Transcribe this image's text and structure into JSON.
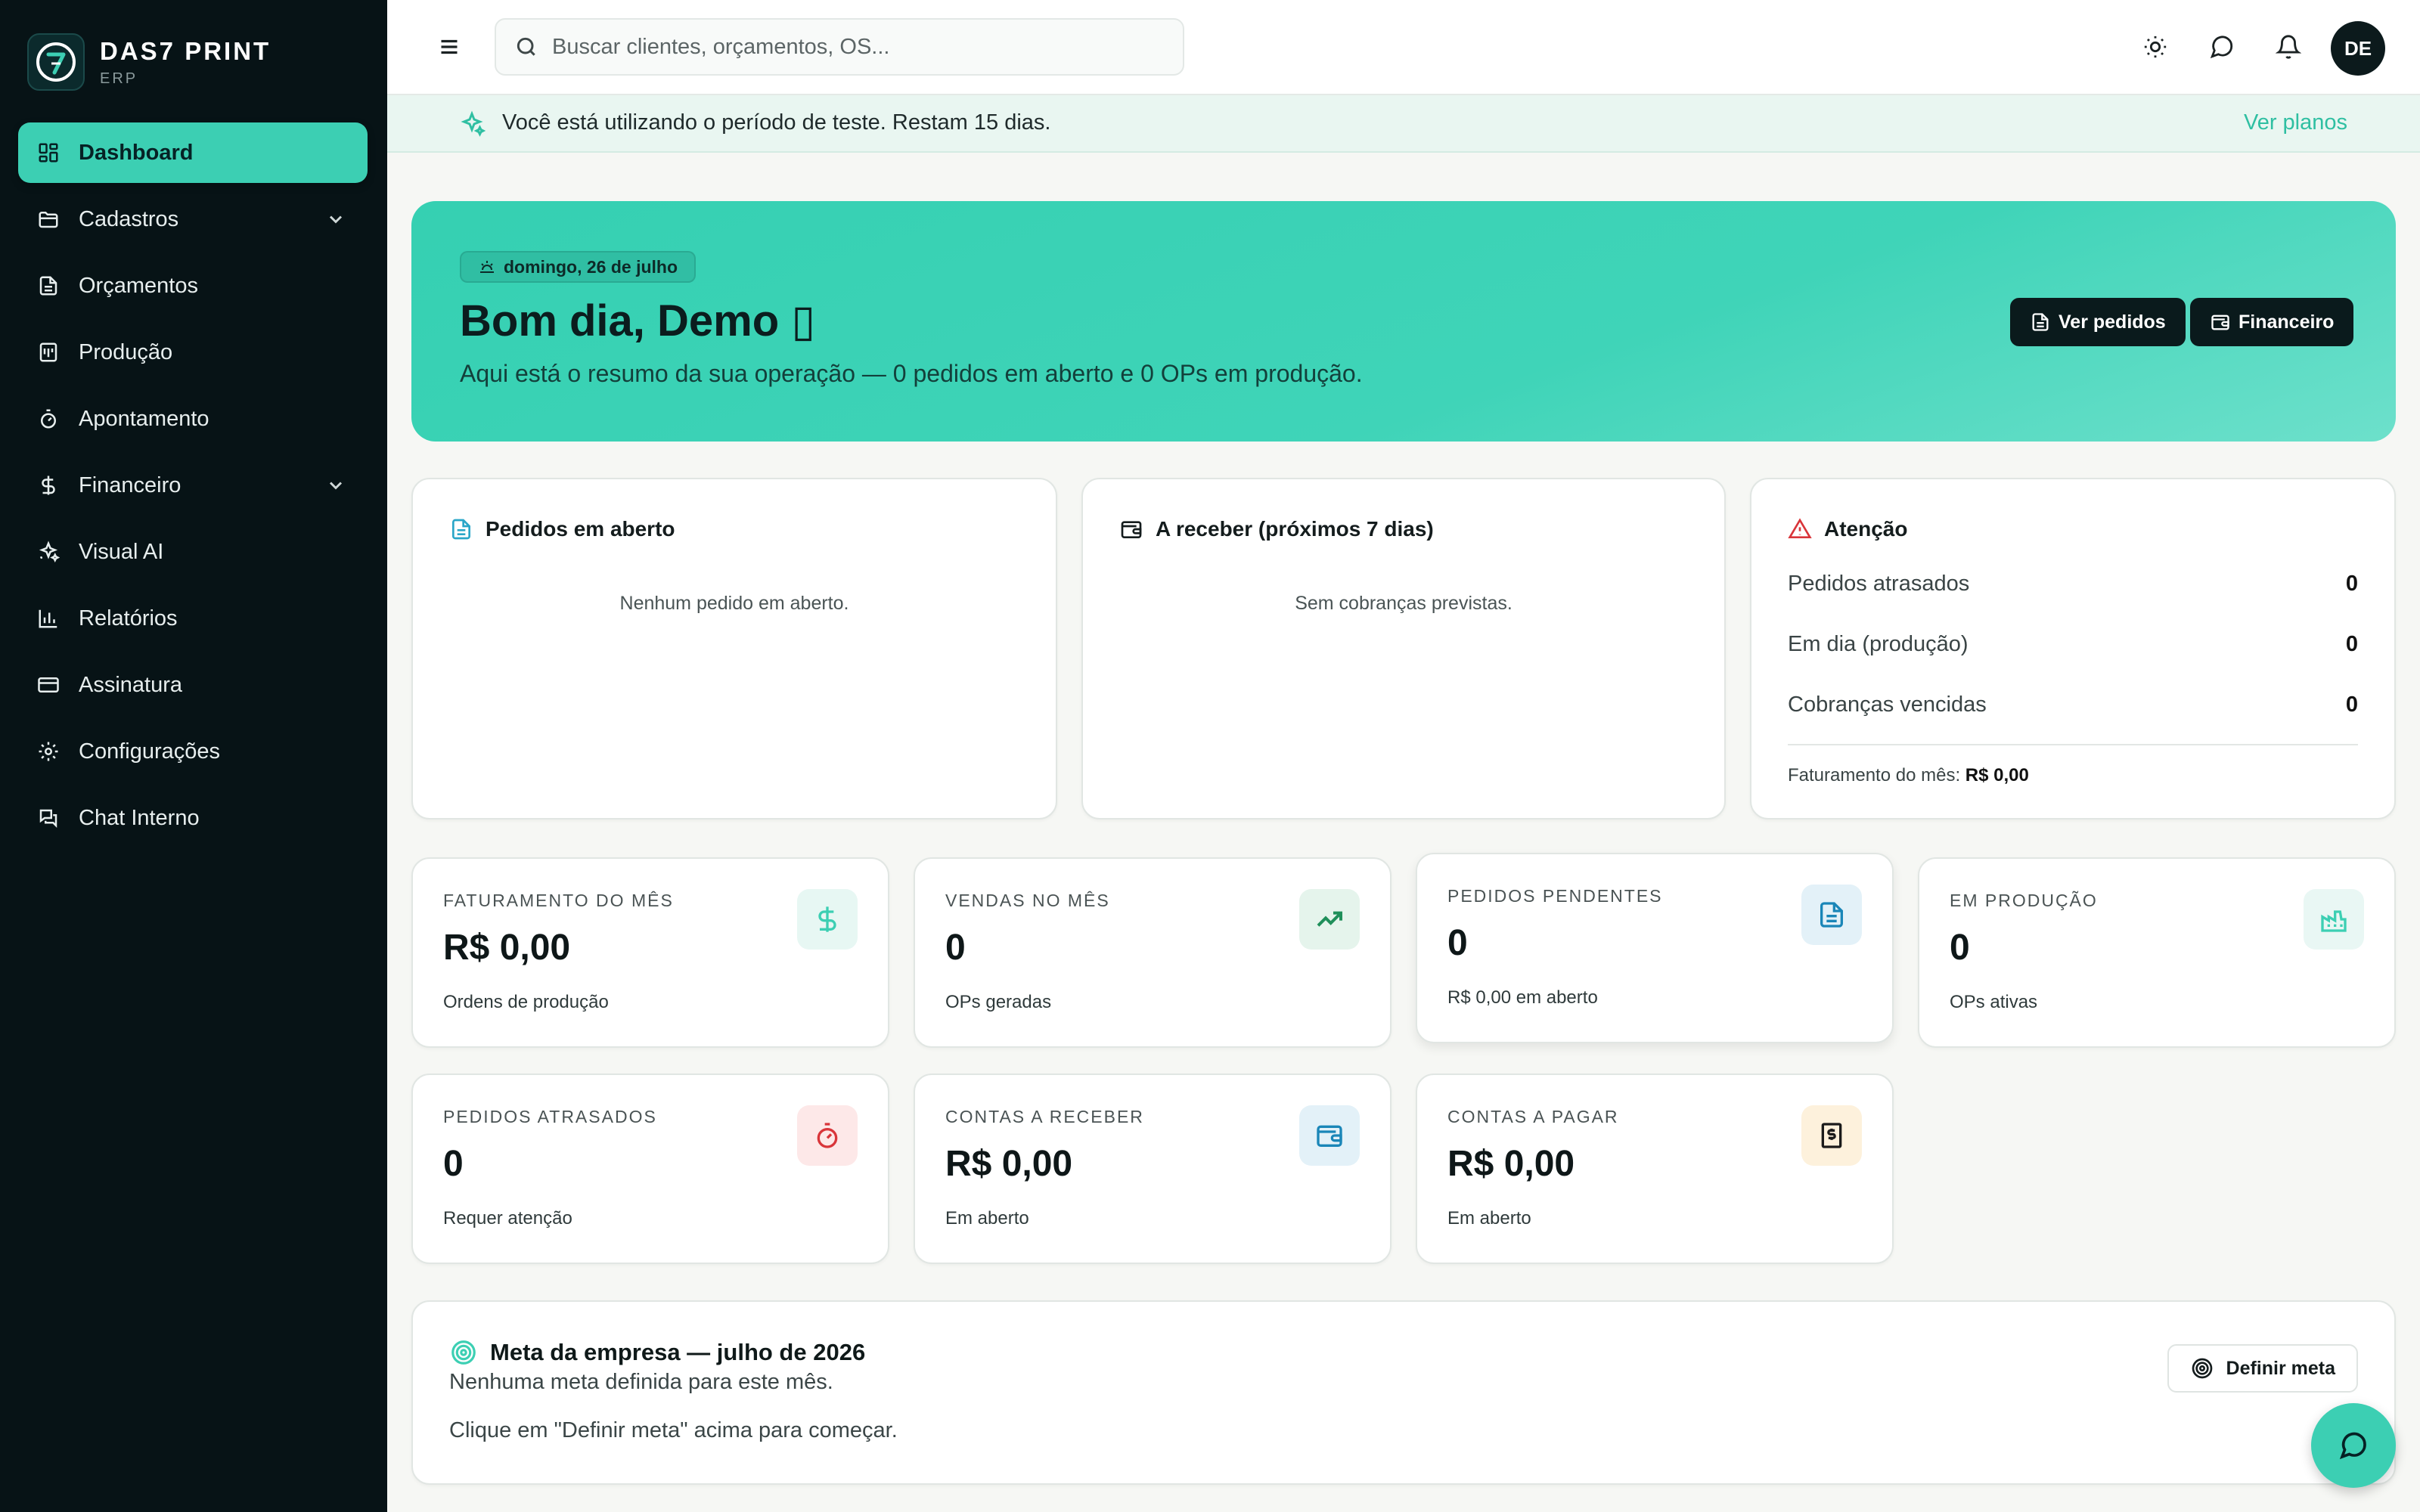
{
  "brand": {
    "name": "DAS7 PRINT",
    "sub": "ERP"
  },
  "sidebar": {
    "items": [
      {
        "label": "Dashboard",
        "icon": "dashboard-icon"
      },
      {
        "label": "Cadastros",
        "icon": "folder-icon"
      },
      {
        "label": "Orçamentos",
        "icon": "document-icon"
      },
      {
        "label": "Produção",
        "icon": "production-icon"
      },
      {
        "label": "Apontamento",
        "icon": "timer-icon"
      },
      {
        "label": "Financeiro",
        "icon": "dollar-icon"
      },
      {
        "label": "Visual AI",
        "icon": "sparkles-icon"
      },
      {
        "label": "Relatórios",
        "icon": "bar-chart-icon"
      },
      {
        "label": "Assinatura",
        "icon": "credit-card-icon"
      },
      {
        "label": "Configurações",
        "icon": "gear-icon"
      },
      {
        "label": "Chat Interno",
        "icon": "chat-icon"
      }
    ]
  },
  "search": {
    "placeholder": "Buscar clientes, orçamentos, OS..."
  },
  "user": {
    "initials": "DE"
  },
  "trial": {
    "text": "Você está utilizando o período de teste. Restam 15 dias.",
    "link": "Ver planos"
  },
  "hero": {
    "date": "domingo, 26 de julho",
    "title": "Bom dia, Demo ▯",
    "subtitle": "Aqui está o resumo da sua operação — 0 pedidos em aberto e 0 OPs em produção.",
    "btn_orders": "Ver pedidos",
    "btn_finance": "Financeiro"
  },
  "open_orders": {
    "title": "Pedidos em aberto",
    "empty": "Nenhum pedido em aberto."
  },
  "receivables": {
    "title": "A receber (próximos 7 dias)",
    "empty": "Sem cobranças previstas."
  },
  "attention": {
    "title": "Atenção",
    "rows": [
      {
        "label": "Pedidos atrasados",
        "value": "0"
      },
      {
        "label": "Em dia (produção)",
        "value": "0"
      },
      {
        "label": "Cobranças vencidas",
        "value": "0"
      }
    ],
    "footer_label": "Faturamento do mês:",
    "footer_value": "R$ 0,00"
  },
  "kpis": [
    {
      "label": "FATURAMENTO DO MÊS",
      "value": "R$ 0,00",
      "sub": "Ordens de produção",
      "icon": "dollar-icon",
      "color": "#3ccfb3",
      "bg": "#e7f7f3"
    },
    {
      "label": "VENDAS NO MÊS",
      "value": "0",
      "sub": "OPs geradas",
      "icon": "trending-up-icon",
      "color": "#1f8f5a",
      "bg": "#e5f4ec"
    },
    {
      "label": "PEDIDOS PENDENTES",
      "value": "0",
      "sub": "R$ 0,00 em aberto",
      "icon": "document-icon",
      "color": "#1a86b8",
      "bg": "#e3f1f8"
    },
    {
      "label": "EM PRODUÇÃO",
      "value": "0",
      "sub": "OPs ativas",
      "icon": "factory-icon",
      "color": "#3ccfb3",
      "bg": "#e9f7f4"
    },
    {
      "label": "PEDIDOS ATRASADOS",
      "value": "0",
      "sub": "Requer atenção",
      "icon": "timer-icon",
      "color": "#d9353a",
      "bg": "#fde8e8"
    },
    {
      "label": "CONTAS A RECEBER",
      "value": "R$ 0,00",
      "sub": "Em aberto",
      "icon": "wallet-icon",
      "color": "#1a86b8",
      "bg": "#e3f1f8"
    },
    {
      "label": "CONTAS A PAGAR",
      "value": "R$ 0,00",
      "sub": "Em aberto",
      "icon": "receipt-icon",
      "color": "#1b1b1b",
      "bg": "#fdf1dc"
    }
  ],
  "goal": {
    "title": "Meta da empresa — julho de 2026",
    "subtitle": "Nenhuma meta definida para este mês.",
    "hint": "Clique em \"Definir meta\" acima para começar.",
    "button": "Definir meta"
  }
}
